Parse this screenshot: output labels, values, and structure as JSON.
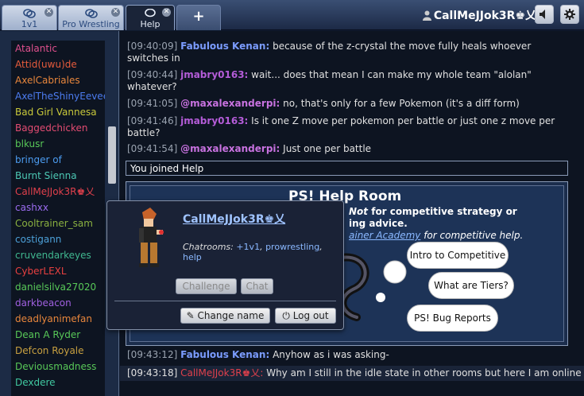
{
  "tabs": [
    {
      "label": "1v1",
      "icon": "chat-bubbles-icon"
    },
    {
      "label": "Pro Wrestling",
      "icon": "chat-bubbles-icon"
    },
    {
      "label": "Help",
      "icon": "chat-bubble-icon",
      "active": true
    }
  ],
  "add_tab_label": "+",
  "header": {
    "username": "CallMeJJok3R♚乂",
    "sound_icon": "speaker-icon",
    "settings_icon": "gear-icon"
  },
  "userlist": [
    {
      "name": "Atalantic",
      "color": "#e0508e"
    },
    {
      "name": "Attid(uwu)de",
      "color": "#e65b3c"
    },
    {
      "name": "AxelCabriales",
      "color": "#e8863c"
    },
    {
      "name": "AxelTheShinyEevee",
      "color": "#4c7cf0"
    },
    {
      "name": "Bad Girl Vannesa",
      "color": "#c9c93a"
    },
    {
      "name": "Baggedchicken",
      "color": "#e44c72"
    },
    {
      "name": "blkusr",
      "color": "#58c858"
    },
    {
      "name": "bringer of",
      "color": "#4c9cf0"
    },
    {
      "name": "Burnt Sienna",
      "color": "#4cc8b4"
    },
    {
      "name": "CallMeJJok3R♚乂",
      "color": "#e0404c"
    },
    {
      "name": "cashxx",
      "color": "#9b6cf0"
    },
    {
      "name": "Cooltrainer_sam",
      "color": "#8ab040"
    },
    {
      "name": "costigann",
      "color": "#4ca0d8"
    },
    {
      "name": "cruvendarkeyes",
      "color": "#40b890"
    },
    {
      "name": "CyberLEXL",
      "color": "#e84040"
    },
    {
      "name": "danielsilva27020",
      "color": "#58c858"
    },
    {
      "name": "darkbeacon",
      "color": "#a060e0"
    },
    {
      "name": "deadlyanimefan",
      "color": "#e8863c"
    },
    {
      "name": "Dean A Ryder",
      "color": "#58c858"
    },
    {
      "name": "Defcon Royale",
      "color": "#c8a040"
    },
    {
      "name": "Deviousmadness",
      "color": "#58c858"
    },
    {
      "name": "Dexdere",
      "color": "#40c8a0"
    }
  ],
  "messages": [
    {
      "time": "[09:40:09]",
      "name": "Fabulous Kenan:",
      "color": "#7b9cff",
      "text": "because of the z-crystal the move fully heals whoever switches in"
    },
    {
      "time": "[09:40:44]",
      "name": "jmabry0163:",
      "color": "#b45cd8",
      "text": "wait... does that mean I can make my whole team \"alolan\" whatever?"
    },
    {
      "time": "[09:41:05]",
      "name": "@maxalexanderpi:",
      "color": "#c872e0",
      "text": "no, that's only for a few Pokemon (it's a diff form)"
    },
    {
      "time": "[09:41:46]",
      "name": "jmabry0163:",
      "color": "#b45cd8",
      "text": "Is it one Z move per pokemon per battle or just one z move per battle?"
    },
    {
      "time": "[09:41:54]",
      "name": "@maxalexanderpi:",
      "color": "#c872e0",
      "text": "Just one per battle"
    }
  ],
  "joined_notice": "You joined Help",
  "help_room": {
    "title": "PS! Help Room",
    "line1_part1": "Not",
    "line1_part2": "for competitive strategy or",
    "line2": "ing advice.",
    "line3_link": "ainer Academy",
    "line3_rest": "for competitive help.",
    "bubbles": [
      "Intro to Competitive",
      "What are Tiers?",
      "PS! Bug Reports"
    ]
  },
  "later_messages": [
    {
      "time": "[09:43:12]",
      "name": "Fabulous Kenan:",
      "color": "#7b9cff",
      "text": "Anyhow as i was asking-"
    },
    {
      "time": "[09:43:18]",
      "name": "CallMeJJok3R♚乂:",
      "color": "#e0404c",
      "text": "Why am I still in the idle state in other rooms but here I am online"
    }
  ],
  "popup": {
    "username": "CallMeJJok3R♚乂",
    "chatrooms_label": "Chatrooms:",
    "rooms": [
      "+1v1",
      "prowrestling",
      "help"
    ],
    "challenge_label": "Challenge",
    "chat_label": "Chat",
    "change_name_label": "Change name",
    "logout_label": "Log out"
  }
}
